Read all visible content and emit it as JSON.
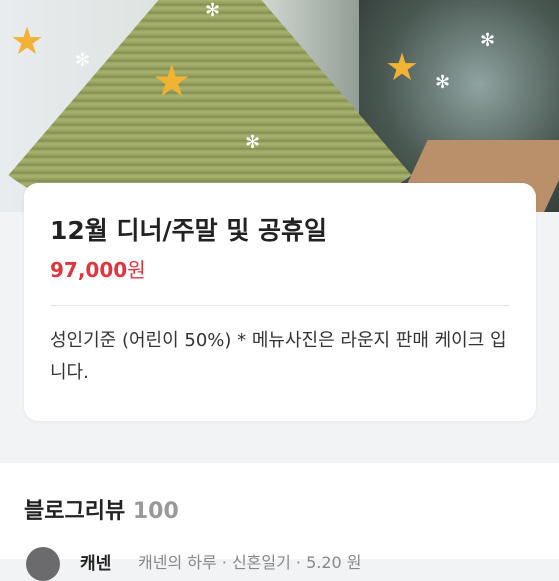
{
  "product": {
    "title": "12월 디너/주말 및 공휴일",
    "price_value": "97,000",
    "price_unit": "원",
    "description": "성인기준 (어린이 50%) * 메뉴사진은 라운지 판매 케이크 입니다."
  },
  "reviews": {
    "title": "블로그리뷰",
    "count": "100",
    "first_name": "캐넨",
    "first_snippet": "캐넨의 하루 · 신혼일기 · 5.20 원"
  },
  "icons": {
    "hero_image": "christmas-tree-cake-photo",
    "avatar": "user-avatar"
  },
  "colors": {
    "price": "#e0343f",
    "background": "#f2f3f5"
  }
}
